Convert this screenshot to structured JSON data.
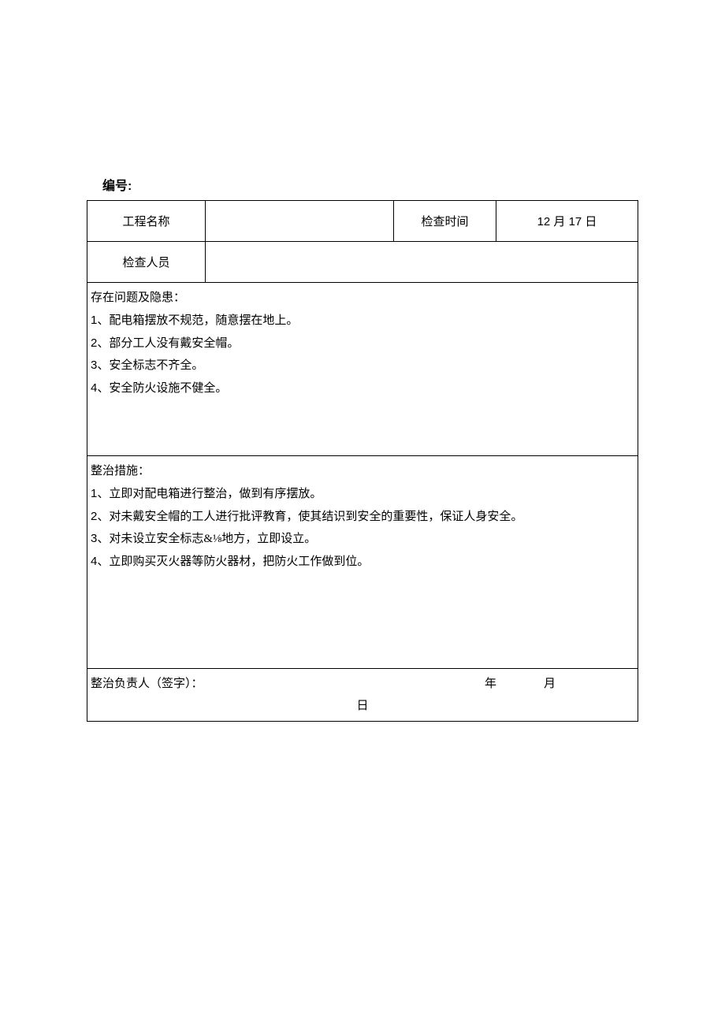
{
  "header": {
    "serial_label": "编号:"
  },
  "row1": {
    "project_name_label": "工程名称",
    "project_name_value": "",
    "check_time_label": "检查时间",
    "check_time_value": "12 月 17 日"
  },
  "row2": {
    "inspector_label": "检查人员",
    "inspector_value": ""
  },
  "issues": {
    "title": "存在问题及隐患：",
    "items": [
      {
        "num": "1",
        "text": "、配电箱摆放不规范，随意摆在地上。"
      },
      {
        "num": "2",
        "text": "、部分工人没有戴安全帽。"
      },
      {
        "num": "3",
        "text": "、安全标志不齐全。"
      },
      {
        "num": "4",
        "text": "、安全防火设施不健全。"
      }
    ]
  },
  "measures": {
    "title": "整治措施：",
    "items": [
      {
        "num": "1",
        "text": "、立即对配电箱进行整治，做到有序摆放。"
      },
      {
        "num": "2",
        "text": "、对未戴安全帽的工人进行批评教育，使其结识到安全的重要性，保证人身安全。"
      },
      {
        "num": "3",
        "text": "、对未设立安全标志&⅛地方，立即设立。"
      },
      {
        "num": "4",
        "text": "、立即购买灭火器等防火器材，把防火工作做到位。"
      }
    ]
  },
  "signature": {
    "responsible_label": "整治负责人（签字）：",
    "year_label": "年",
    "month_label": "月",
    "day_label": "日"
  }
}
